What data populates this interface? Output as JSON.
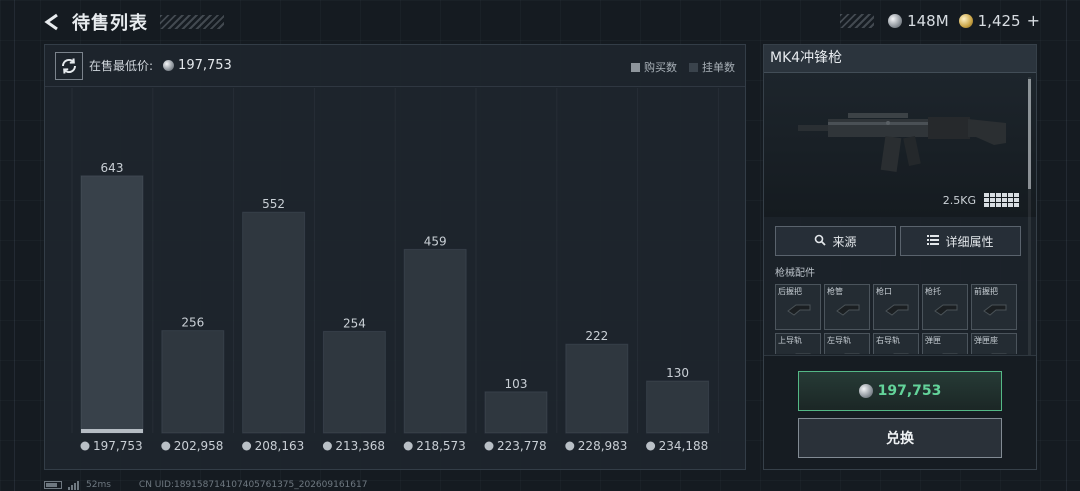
{
  "header": {
    "title": "待售列表",
    "silver_amount": "148M",
    "gold_amount": "1,425"
  },
  "chart_panel": {
    "lowest_price_label": "在售最低价:",
    "lowest_price_value": "197,753",
    "legend": [
      {
        "label": "购买数",
        "color": "#8e959c"
      },
      {
        "label": "挂单数",
        "color": "#3a434c"
      }
    ]
  },
  "chart_data": {
    "type": "bar",
    "title": "",
    "categories": [
      "197,753",
      "202,958",
      "208,163",
      "213,368",
      "218,573",
      "223,778",
      "228,983",
      "234,188"
    ],
    "series": [
      {
        "name": "挂单数",
        "values": [
          643,
          256,
          552,
          254,
          459,
          103,
          222,
          130
        ]
      }
    ],
    "highlighted_category": "197,753",
    "ylim": [
      0,
      700
    ],
    "grid": true,
    "legend_position": "top-right"
  },
  "detail": {
    "item_name": "MK4冲锋枪",
    "weight": "2.5KG",
    "source_button": "来源",
    "details_button": "详细属性",
    "attachments_label": "枪械配件",
    "attachments": [
      "后握把",
      "枪管",
      "枪口",
      "枪托",
      "前握把",
      "上导轨",
      "左导轨",
      "右导轨",
      "弹匣",
      "弹匣座"
    ],
    "buy_price": "197,753",
    "exchange_button": "兑换"
  },
  "footer": {
    "ping": "52ms",
    "uid": "CN UID:18915871410740576137​5_202609161617"
  }
}
